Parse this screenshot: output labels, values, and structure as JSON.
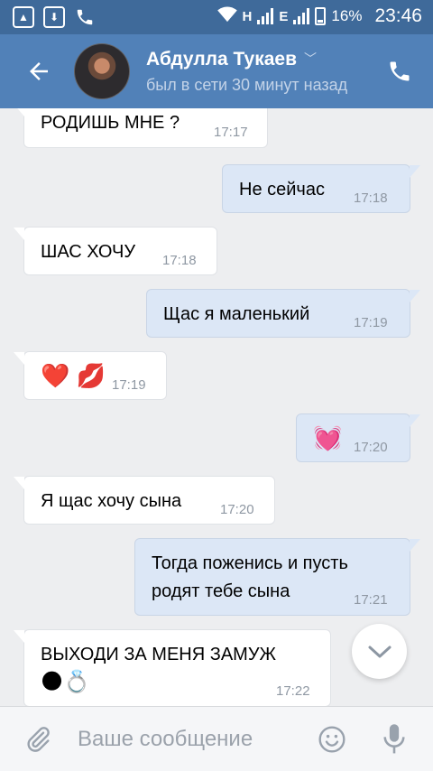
{
  "status_bar": {
    "net_h": "H",
    "net_e": "E",
    "battery": "16%",
    "time": "23:46"
  },
  "header": {
    "contact_name": "Абдулла Тукаев",
    "last_seen": "был в сети 30 минут назад"
  },
  "messages": [
    {
      "dir": "in",
      "text": "РОДИШЬ МНЕ ?",
      "time": "17:17"
    },
    {
      "dir": "out",
      "text": "Не сейчас",
      "time": "17:18"
    },
    {
      "dir": "in",
      "text": "ШАС ХОЧУ",
      "time": "17:18"
    },
    {
      "dir": "out",
      "text": "Щас я маленький",
      "time": "17:19"
    },
    {
      "dir": "in",
      "text": "❤️ 💋",
      "time": "17:19"
    },
    {
      "dir": "out",
      "text": "💓",
      "time": "17:20"
    },
    {
      "dir": "in",
      "text": "Я щас хочу сына",
      "time": "17:20"
    },
    {
      "dir": "out",
      "line1": "Тогда поженись и пусть",
      "line2": "родят тебе сына",
      "time": "17:21"
    },
    {
      "dir": "in",
      "line1": "ВЫХОДИ ЗА МЕНЯ ЗАМУЖ",
      "line2": "🌑💍",
      "time": "17:22"
    }
  ],
  "composer": {
    "placeholder": "Ваше сообщение"
  },
  "icons": {
    "back": "arrow-left-icon",
    "call": "phone-icon",
    "attach": "paperclip-icon",
    "emoji": "smile-icon",
    "voice": "microphone-icon",
    "scroll": "chevron-down-icon"
  },
  "colors": {
    "header": "#5181b8",
    "status_bar": "#3f6a9a",
    "chat_bg": "#edeef0",
    "incoming_bubble": "#ffffff",
    "outgoing_bubble": "#dce7f6"
  }
}
